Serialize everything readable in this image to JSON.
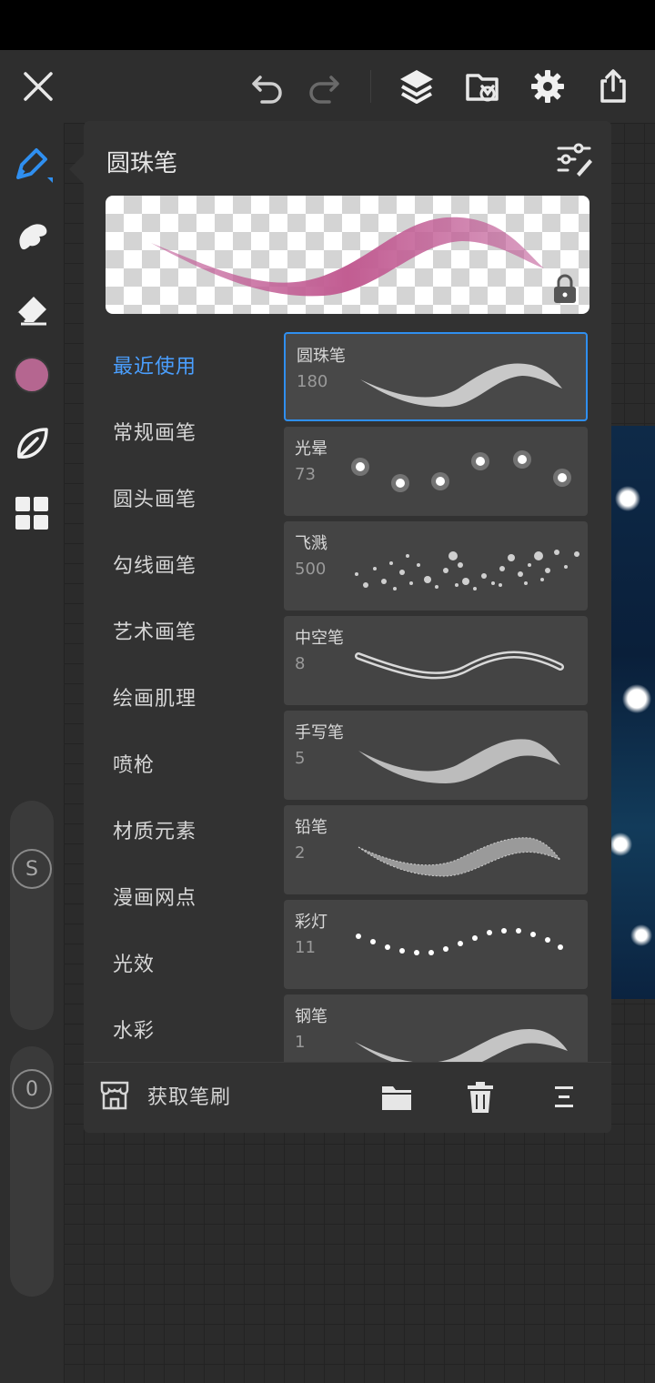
{
  "app": {
    "accent_color": "#2f8ff0",
    "current_color": "#b56690"
  },
  "topbar": {
    "icons": [
      "close-icon",
      "undo-icon",
      "redo-icon",
      "layers-icon",
      "import-icon",
      "settings-icon",
      "share-icon"
    ]
  },
  "sidebar": {
    "tools": [
      "brush-icon",
      "smudge-icon",
      "eraser-icon",
      "color-swatch",
      "leaf-icon",
      "grid-icon"
    ],
    "size_slider_label": "S",
    "opacity_slider_label": "0"
  },
  "panel": {
    "title": "圆珠笔",
    "categories": [
      {
        "label": "最近使用",
        "active": true
      },
      {
        "label": "常规画笔",
        "active": false
      },
      {
        "label": "圆头画笔",
        "active": false
      },
      {
        "label": "勾线画笔",
        "active": false
      },
      {
        "label": "艺术画笔",
        "active": false
      },
      {
        "label": "绘画肌理",
        "active": false
      },
      {
        "label": "喷枪",
        "active": false
      },
      {
        "label": "材质元素",
        "active": false
      },
      {
        "label": "漫画网点",
        "active": false
      },
      {
        "label": "光效",
        "active": false
      },
      {
        "label": "水彩",
        "active": false
      }
    ],
    "brushes": [
      {
        "name": "圆珠笔",
        "count": "180",
        "selected": true
      },
      {
        "name": "光晕",
        "count": "73",
        "selected": false
      },
      {
        "name": "飞溅",
        "count": "500",
        "selected": false
      },
      {
        "name": "中空笔",
        "count": "8",
        "selected": false
      },
      {
        "name": "手写笔",
        "count": "5",
        "selected": false
      },
      {
        "name": "铅笔",
        "count": "2",
        "selected": false
      },
      {
        "name": "彩灯",
        "count": "11",
        "selected": false
      },
      {
        "name": "钢笔",
        "count": "1",
        "selected": false
      }
    ],
    "footer": {
      "get_brush_label": "获取笔刷"
    }
  }
}
